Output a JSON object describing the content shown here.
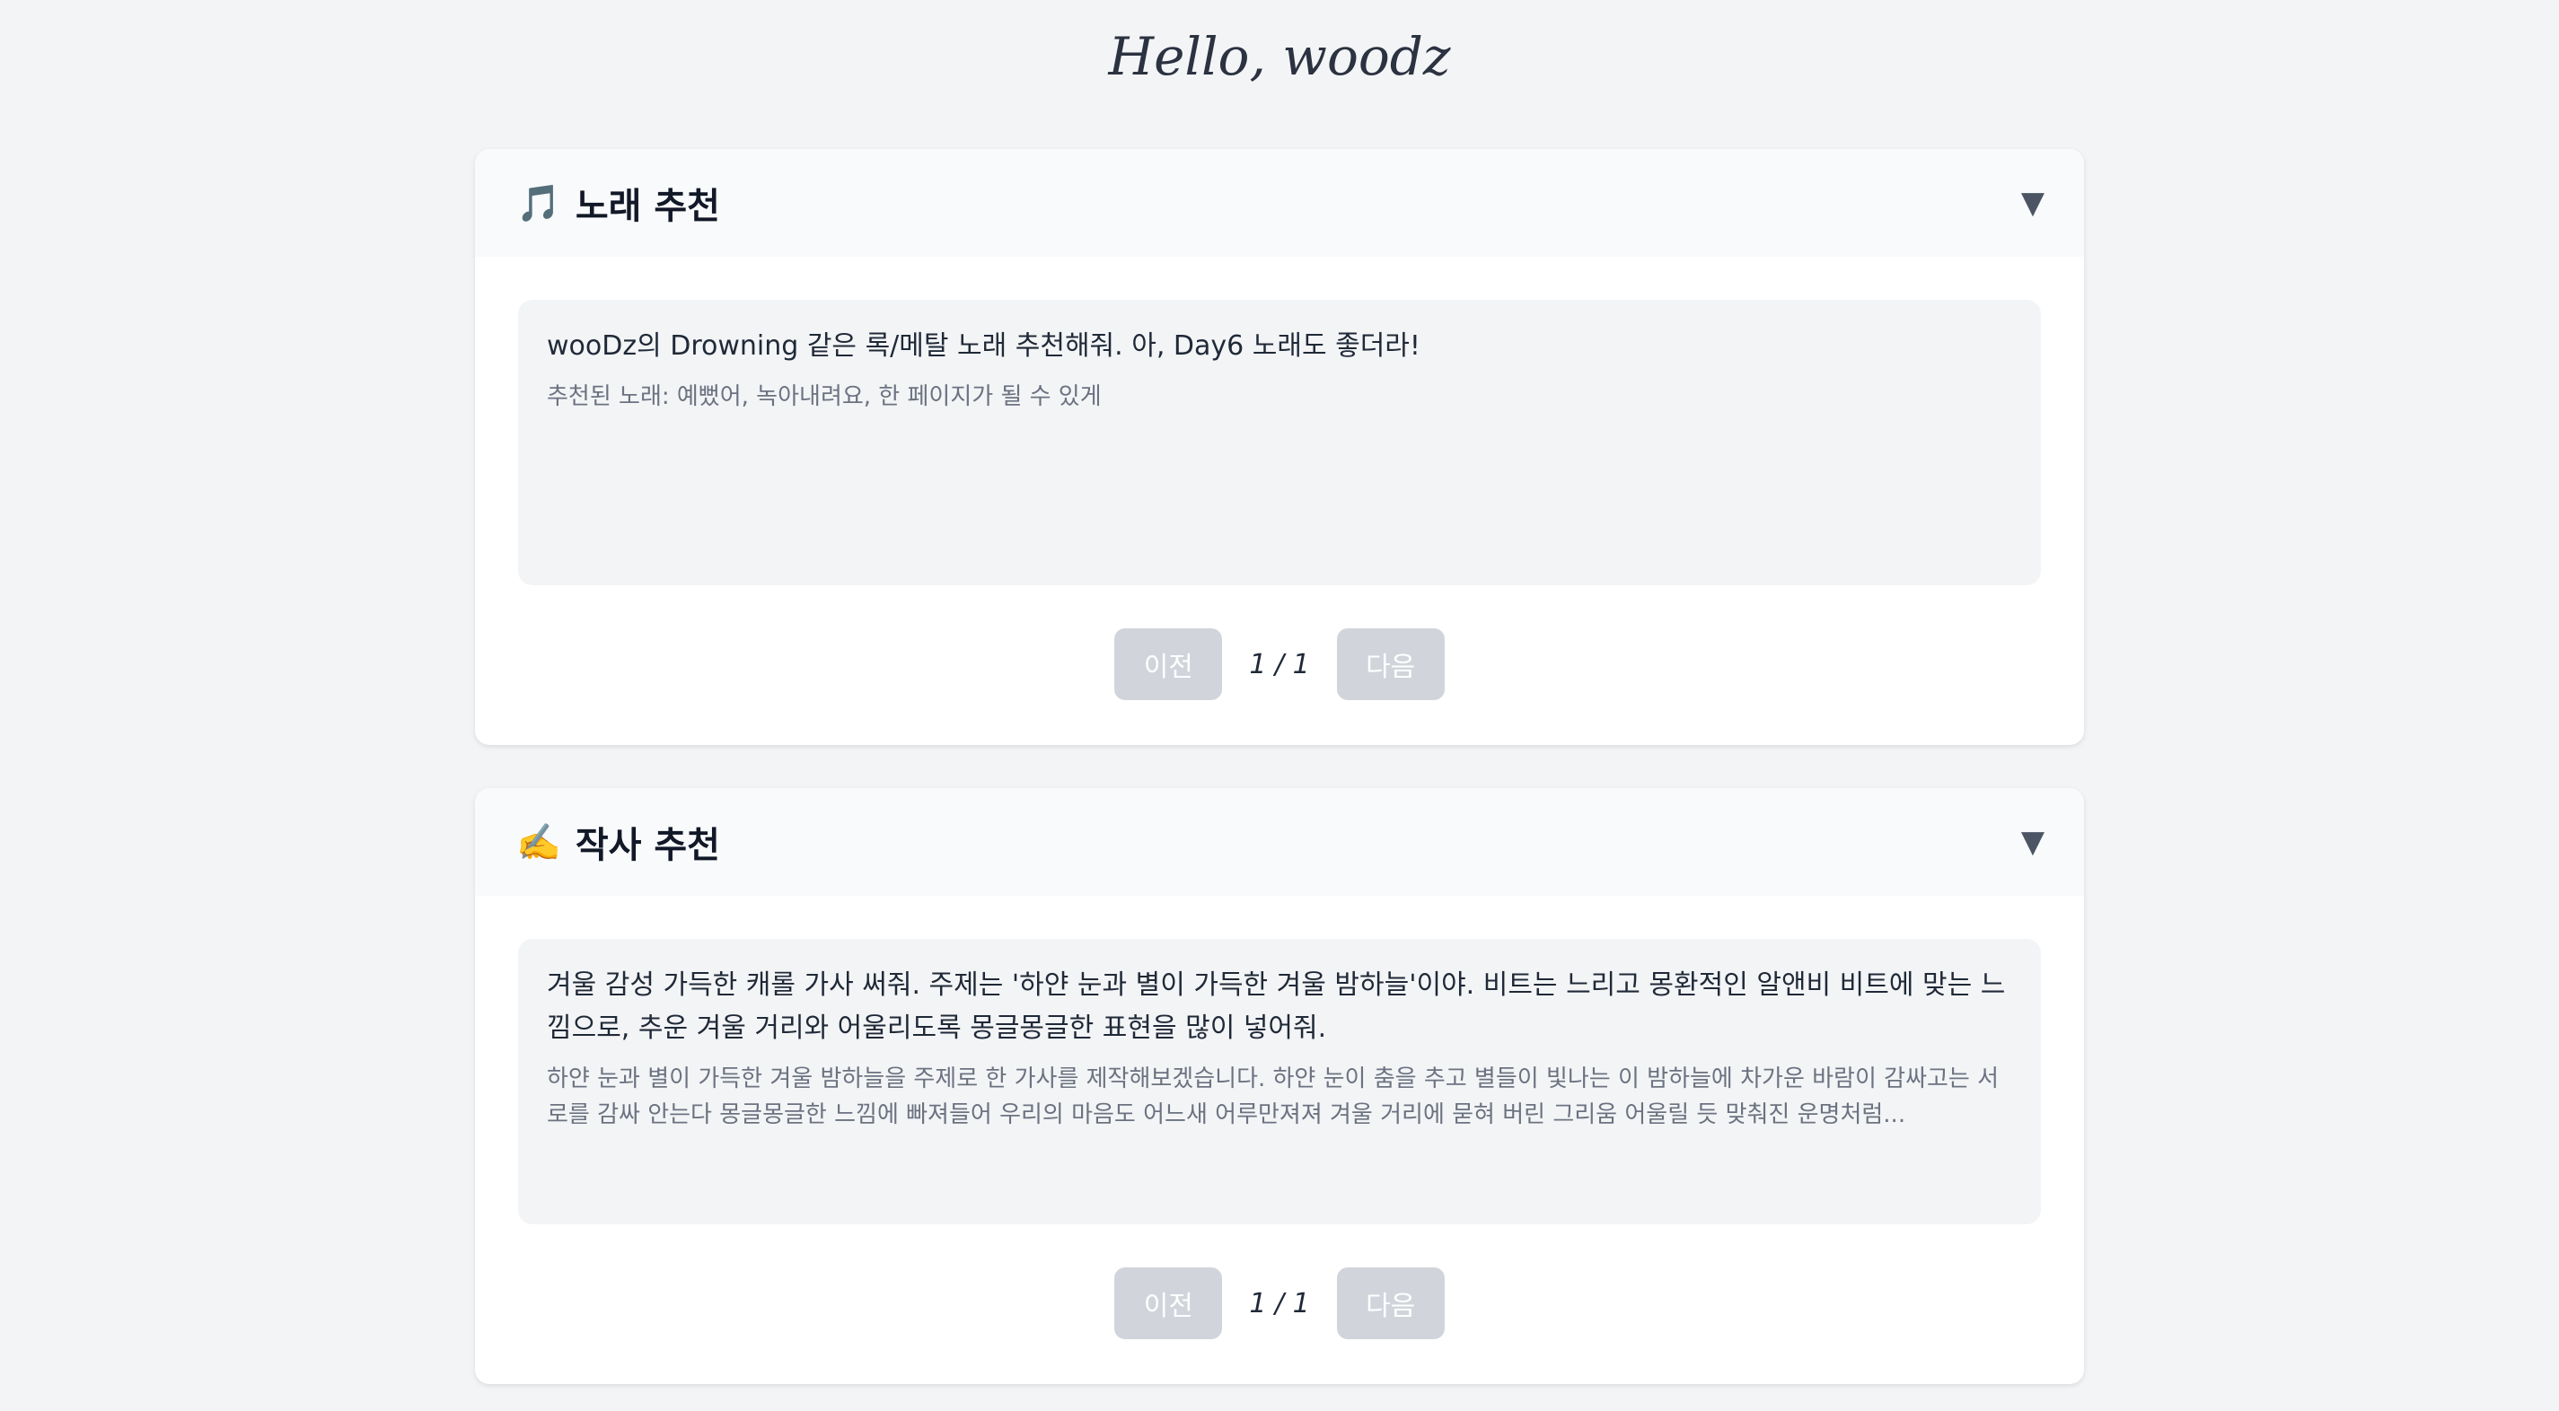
{
  "greeting": "Hello, woodz",
  "sections": [
    {
      "icon": "music-note-icon",
      "icon_glyph": "🎵",
      "title": "노래 추천",
      "toggle": "▼",
      "prompt": "wooDz의 Drowning 같은 록/메탈 노래 추천해줘. 아, Day6 노래도 좋더라!",
      "response": "추천된 노래: 예뻤어, 녹아내려요, 한 페이지가 될 수 있게",
      "prev_label": "이전",
      "next_label": "다음",
      "page": "1 / 1"
    },
    {
      "icon": "writing-hand-icon",
      "icon_glyph": "✍️",
      "title": "작사 추천",
      "toggle": "▼",
      "prompt": "겨울 감성 가득한 캐롤 가사 써줘. 주제는 '하얀 눈과 별이 가득한 겨울 밤하늘'이야. 비트는 느리고 몽환적인 알앤비 비트에 맞는 느낌으로, 추운 겨울 거리와 어울리도록 몽글몽글한 표현을 많이 넣어줘.",
      "response": "하얀 눈과 별이 가득한 겨울 밤하늘을 주제로 한 가사를 제작해보겠습니다. 하얀 눈이 춤을 추고 별들이 빛나는 이 밤하늘에 차가운 바람이 감싸고는 서로를 감싸 안는다 몽글몽글한 느낌에 빠져들어 우리의 마음도 어느새 어루만져져 겨울 거리에 묻혀 버린 그리움 어울릴 듯 맞춰진 운명처럼...",
      "prev_label": "이전",
      "next_label": "다음",
      "page": "1 / 1"
    }
  ]
}
